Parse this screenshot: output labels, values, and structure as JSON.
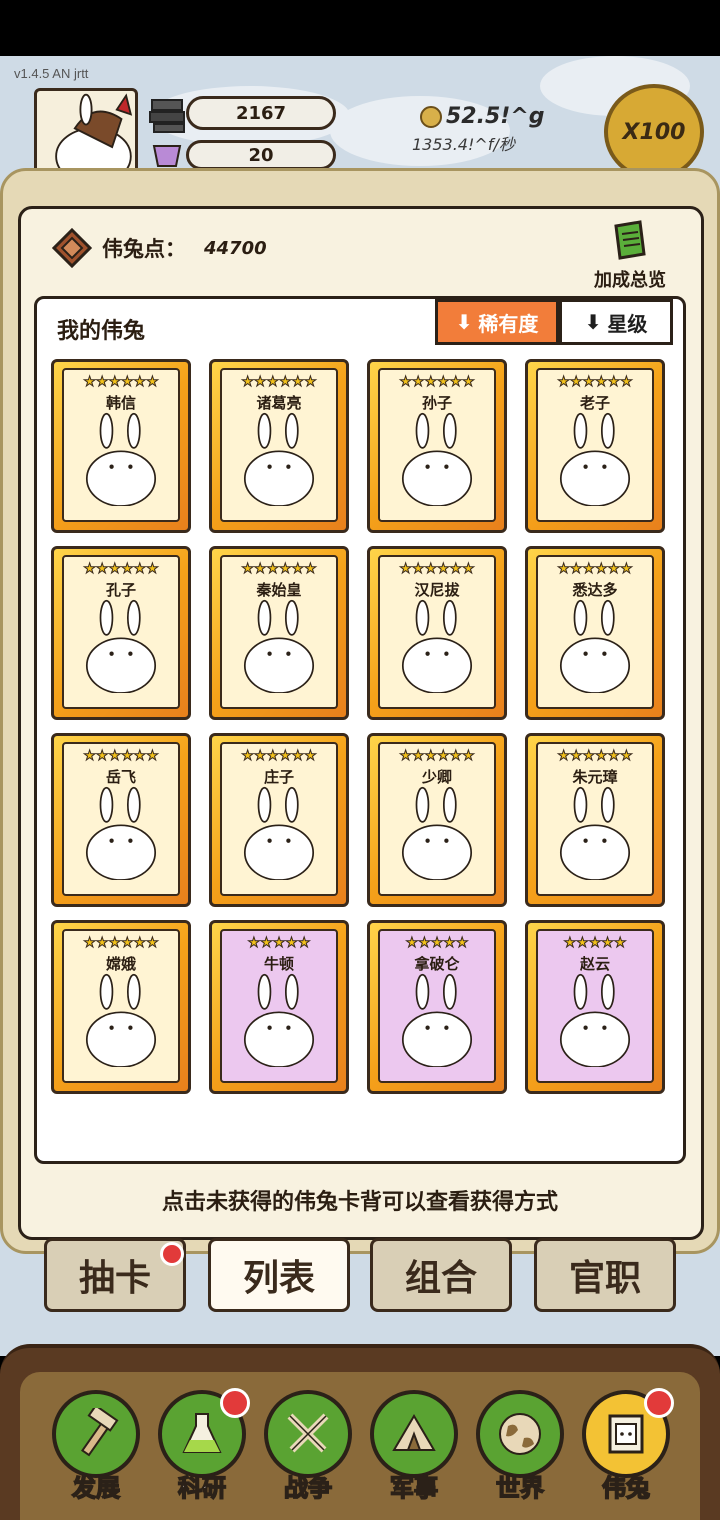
{
  "version": "v1.4.5 AN jrtt",
  "resources": {
    "iron": "2167",
    "gem": "20",
    "coins": "52.5!^g",
    "coins_rate": "1353.4!^f/秒",
    "multiplier": "X100"
  },
  "panel": {
    "points_label": "伟兔点：",
    "points_value": "44700",
    "bonus_label": "加成总览",
    "list_title": "我的伟兔",
    "sort_rarity": "稀有度",
    "sort_star": "星级",
    "hint": "点击未获得的伟兔卡背可以查看获得方式"
  },
  "cards": [
    {
      "name": "韩信",
      "stars": "★★★★★★",
      "tier": "gold"
    },
    {
      "name": "诸葛亮",
      "stars": "★★★★★★",
      "tier": "gold"
    },
    {
      "name": "孙子",
      "stars": "★★★★★★",
      "tier": "gold"
    },
    {
      "name": "老子",
      "stars": "★★★★★★",
      "tier": "gold"
    },
    {
      "name": "孔子",
      "stars": "★★★★★★",
      "tier": "gold"
    },
    {
      "name": "秦始皇",
      "stars": "★★★★★★",
      "tier": "gold"
    },
    {
      "name": "汉尼拔",
      "stars": "★★★★★★",
      "tier": "gold"
    },
    {
      "name": "悉达多",
      "stars": "★★★★★★",
      "tier": "gold"
    },
    {
      "name": "岳飞",
      "stars": "★★★★★★",
      "tier": "gold"
    },
    {
      "name": "庄子",
      "stars": "★★★★★★",
      "tier": "gold"
    },
    {
      "name": "少卿",
      "stars": "★★★★★★",
      "tier": "gold"
    },
    {
      "name": "朱元璋",
      "stars": "★★★★★★",
      "tier": "gold"
    },
    {
      "name": "嫦娥",
      "stars": "★★★★★★",
      "tier": "gold"
    },
    {
      "name": "牛顿",
      "stars": "★★★★★",
      "tier": "purple"
    },
    {
      "name": "拿破仑",
      "stars": "★★★★★",
      "tier": "purple"
    },
    {
      "name": "赵云",
      "stars": "★★★★★",
      "tier": "purple"
    }
  ],
  "tabs": [
    {
      "label": "抽卡",
      "badge": true
    },
    {
      "label": "列表",
      "badge": false
    },
    {
      "label": "组合",
      "badge": false
    },
    {
      "label": "官职",
      "badge": false
    }
  ],
  "nav": [
    {
      "label": "发展",
      "icon": "hammer-icon",
      "badge": false
    },
    {
      "label": "科研",
      "icon": "flask-icon",
      "badge": true
    },
    {
      "label": "战争",
      "icon": "swords-icon",
      "badge": false
    },
    {
      "label": "军事",
      "icon": "tent-icon",
      "badge": false
    },
    {
      "label": "世界",
      "icon": "globe-icon",
      "badge": false
    },
    {
      "label": "伟兔",
      "icon": "rabbit-card-icon",
      "badge": true
    }
  ]
}
